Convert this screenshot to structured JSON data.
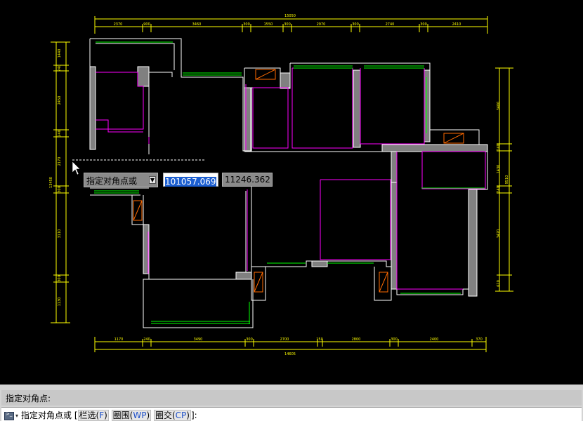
{
  "dimensions": {
    "top_total": "15050",
    "top_segments": [
      "2370",
      "900",
      "3460",
      "300",
      "1550",
      "300",
      "2970",
      "300",
      "2740",
      "300",
      "2410"
    ],
    "bottom_total": "14605",
    "bottom_segments": [
      "1170",
      "240",
      "3490",
      "300",
      "2700",
      "150",
      "2800",
      "300",
      "2400",
      "370"
    ],
    "left_total": "13450",
    "left_segments": [
      "1440",
      "240",
      "2450",
      "240",
      "2170",
      "300",
      "3110",
      "300",
      "1130"
    ],
    "right_total": "9510",
    "right_segments": [
      "3400",
      "240",
      "1430",
      "240",
      "3470",
      "620"
    ]
  },
  "dynamic_input": {
    "prompt": "指定对角点或",
    "dropdown_glyph": "▼",
    "x_value": "101057.069",
    "y_value": "11246.362"
  },
  "command_line": {
    "history": "指定对角点:",
    "prompt_prefix": "指定对角点或 [",
    "options": [
      {
        "label": "栏选",
        "key": "F"
      },
      {
        "label": "圈围",
        "key": "WP"
      },
      {
        "label": "圈交",
        "key": "CP"
      }
    ],
    "prompt_suffix": "]:"
  },
  "colors": {
    "background": "#000000",
    "wall": "#ffffff",
    "wall_fill": "#808080",
    "furniture": "#ff00ff",
    "window": "#00ff00",
    "dimension": "#ffff00",
    "shaft": "#ff6a00",
    "selection_highlight": "#1c5fd1"
  }
}
